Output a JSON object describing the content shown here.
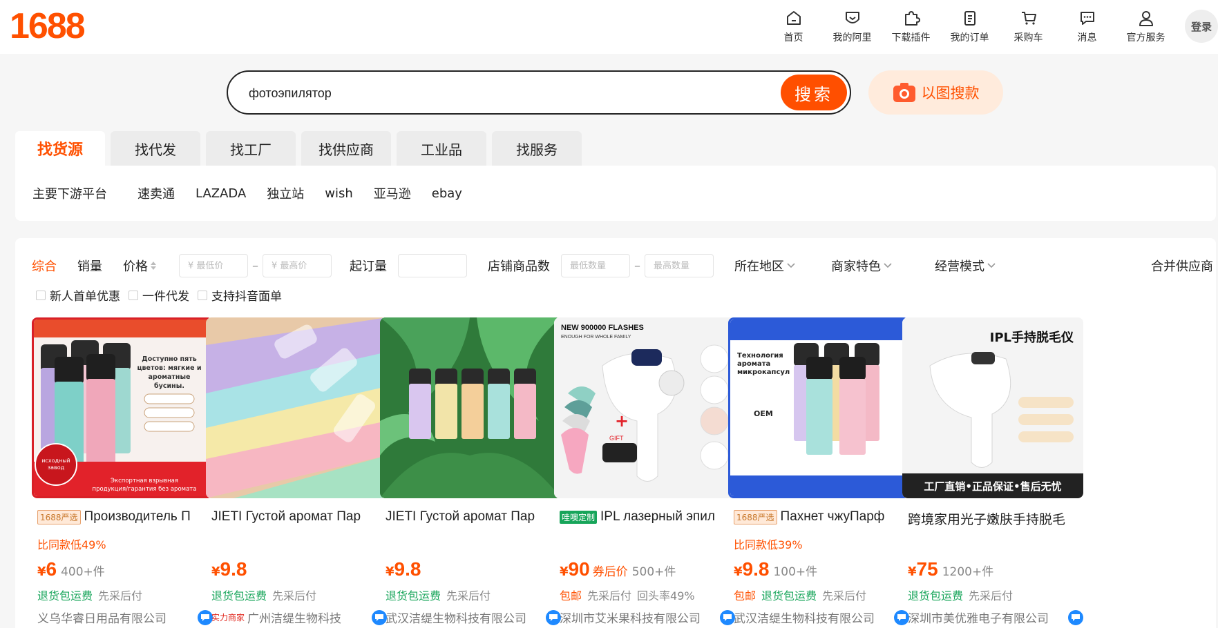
{
  "header": {
    "logo": "1688",
    "nav": [
      {
        "label": "首页",
        "icon": "home-icon"
      },
      {
        "label": "我的阿里",
        "icon": "heart-shield-icon"
      },
      {
        "label": "下载插件",
        "icon": "puzzle-icon"
      },
      {
        "label": "我的订单",
        "icon": "clipboard-icon"
      },
      {
        "label": "采购车",
        "icon": "cart-icon"
      },
      {
        "label": "消息",
        "icon": "message-icon"
      },
      {
        "label": "官方服务",
        "icon": "user-icon"
      }
    ],
    "login": "登录"
  },
  "search": {
    "query": "фотоэпилятор",
    "button": "搜索",
    "image_search": "以图搜款"
  },
  "tabs": [
    "找货源",
    "找代发",
    "找工厂",
    "找供应商",
    "工业品",
    "找服务"
  ],
  "platforms": {
    "label": "主要下游平台",
    "items": [
      "速卖通",
      "LAZADA",
      "独立站",
      "wish",
      "亚马逊",
      "ebay"
    ]
  },
  "filters": {
    "sorts": [
      "综合",
      "销量",
      "价格"
    ],
    "min_price_placeholder": "¥ 最低价",
    "max_price_placeholder": "¥ 最高价",
    "moq_label": "起订量",
    "shop_count_label": "店铺商品数",
    "min_count_placeholder": "最低数量",
    "max_count_placeholder": "最高数量",
    "region": "所在地区",
    "merchant": "商家特色",
    "mode": "经营模式",
    "merge": "合并供应商",
    "checks": [
      "新人首单优惠",
      "一件代发",
      "支持抖音面单"
    ]
  },
  "products": [
    {
      "badge": "1688严选",
      "title": "Производитель П",
      "discount": "比同款低49%",
      "yen": "¥",
      "price": "6",
      "coupon": "",
      "sales": "400+件",
      "tags": [
        "退货包运费",
        "先采后付"
      ],
      "strength": "",
      "company": "义乌华睿日用品有限公司",
      "image_text": "Доступно пять цветов: мягкие и ароматные бусины."
    },
    {
      "badge": "",
      "title": "JIETI Густой аромат Пар",
      "discount": "",
      "yen": "¥",
      "price": "9.8",
      "coupon": "",
      "sales": "",
      "tags": [
        "退货包运费",
        "先采后付"
      ],
      "strength": "实力商家",
      "company": "广州洁缇生物科技",
      "image_text": ""
    },
    {
      "badge": "",
      "title": "JIETI Густой аромат Пар",
      "discount": "",
      "yen": "¥",
      "price": "9.8",
      "coupon": "",
      "sales": "",
      "tags": [
        "退货包运费",
        "先采后付"
      ],
      "strength": "",
      "company": "武汉洁缇生物科技有限公司",
      "image_text": ""
    },
    {
      "badge": "哇噢定制",
      "title": "IPL лазерный эпил",
      "discount": "",
      "yen": "¥",
      "price": "90",
      "coupon": "券后价",
      "sales": "500+件",
      "tags": [
        "包邮",
        "先采后付",
        "回头率49%"
      ],
      "strength": "",
      "company": "深圳市艾米果科技有限公司",
      "image_text": "NEW 900000 FLASHES"
    },
    {
      "badge": "1688严选",
      "title": "Пахнет чжуПарф",
      "discount": "比同款低39%",
      "yen": "¥",
      "price": "9.8",
      "coupon": "",
      "sales": "100+件",
      "tags": [
        "包邮",
        "退货包运费",
        "先采后付"
      ],
      "strength": "",
      "company": "武汉洁缇生物科技有限公司",
      "image_text": "Технология аромата микрокапсул"
    },
    {
      "badge": "",
      "title": "跨境家用光子嫩肤手持脱毛",
      "discount": "",
      "yen": "¥",
      "price": "75",
      "coupon": "",
      "sales": "1200+件",
      "tags": [
        "退货包运费",
        "先采后付"
      ],
      "strength": "",
      "company": "深圳市美优雅电子有限公司",
      "image_text": "IPL手持脱毛仪"
    }
  ],
  "image_captions": {
    "p4_sub": "ENOUGH FOR WHOLE FAMILY",
    "p4_gift": "GIFT",
    "p6_banner": "工厂直销•正品保证•售后无忧",
    "p1_banner": "Экспортная взрывная продукция/гарантия без аромата",
    "p1_seal": "исходный завод",
    "p5_oem": "OEM"
  },
  "colors": {
    "brand": "#ff5000",
    "green": "#17a55a"
  }
}
